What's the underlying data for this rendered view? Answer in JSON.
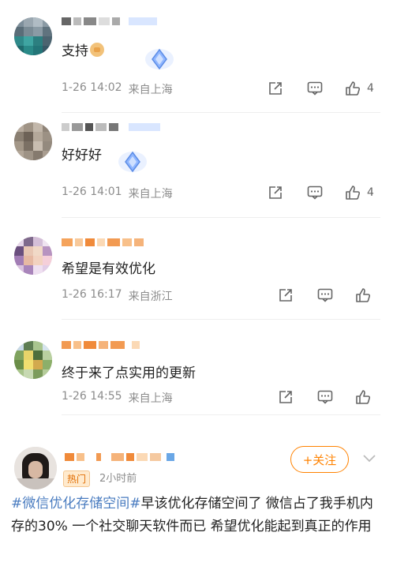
{
  "comments": [
    {
      "text": "支持",
      "time": "1-26 14:02",
      "location": "来自上海",
      "likes": "4"
    },
    {
      "text": "好好好",
      "time": "1-26 14:01",
      "location": "来自上海",
      "likes": "4"
    },
    {
      "text": "希望是有效优化",
      "time": "1-26 16:17",
      "location": "来自浙江",
      "likes": ""
    },
    {
      "text": "终于来了点实用的更新",
      "time": "1-26 14:55",
      "location": "来自上海",
      "likes": ""
    }
  ],
  "post": {
    "hot_label": "热门",
    "time": "2小时前",
    "follow_label": "+关注",
    "topic": "#微信优化存储空间#",
    "body": "早该优化存储空间了 微信占了我手机内存的30% 一个社交聊天软件而已 希望优化能起到真正的作用"
  },
  "icons": {
    "share": "share-icon",
    "comment": "comment-icon",
    "like": "thumbs-up-icon",
    "badge": "diamond-badge-icon",
    "more": "chevron-down-icon"
  },
  "colors": {
    "accent": "#ff8200",
    "topic": "#4a7cc0",
    "meta": "#8c8c8c"
  }
}
